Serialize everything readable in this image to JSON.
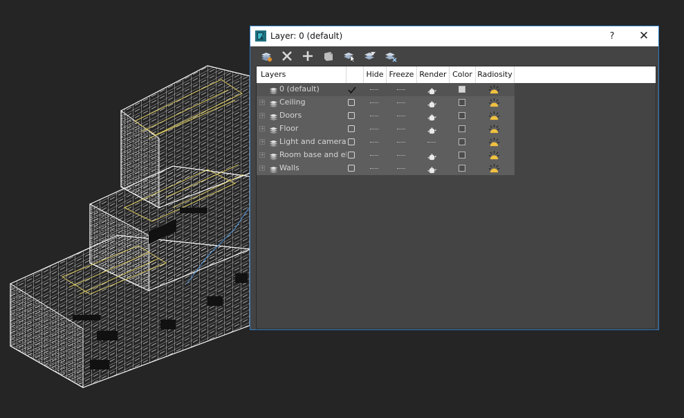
{
  "dialog": {
    "title": "Layer: 0 (default)",
    "help_label": "?",
    "close_label": "✕"
  },
  "toolbar": {
    "tools": [
      {
        "icon": "new-layer-icon"
      },
      {
        "icon": "delete-icon"
      },
      {
        "icon": "add-icon"
      },
      {
        "icon": "select-layer-icon"
      },
      {
        "icon": "select-objects-icon"
      },
      {
        "icon": "hide-all-icon"
      },
      {
        "icon": "freeze-all-icon"
      }
    ]
  },
  "grid": {
    "columns": [
      "Layers",
      "",
      "Hide",
      "Freeze",
      "Render",
      "Color",
      "Radiosity"
    ],
    "rows": [
      {
        "name": "0 (default)",
        "active": true,
        "expandable": false
      },
      {
        "name": "Ceiling",
        "active": false,
        "expandable": true
      },
      {
        "name": "Doors",
        "active": false,
        "expandable": true
      },
      {
        "name": "Floor",
        "active": false,
        "expandable": true
      },
      {
        "name": "Light and camera",
        "active": false,
        "expandable": true
      },
      {
        "name": "Room base and elements",
        "active": false,
        "expandable": true
      },
      {
        "name": "Walls",
        "active": false,
        "expandable": true
      }
    ]
  },
  "colors": {
    "accent": "#2f7fc6",
    "panel": "#444444",
    "row": "#5e5e5e",
    "radiosity": "#f0c040"
  }
}
